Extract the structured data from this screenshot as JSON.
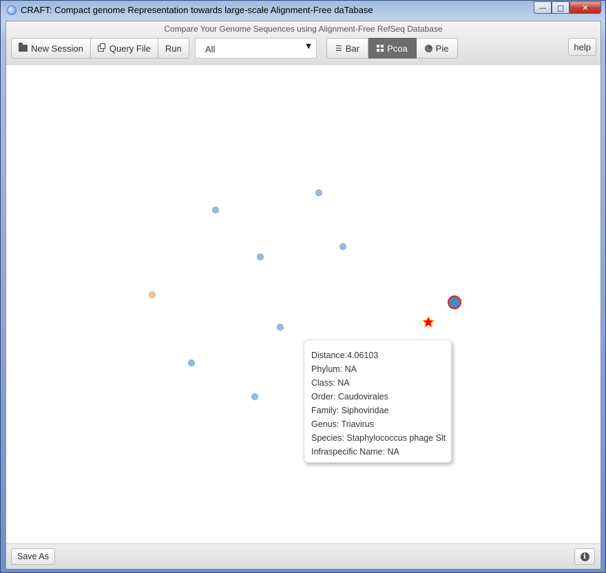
{
  "window": {
    "title": "CRAFT: Compact genome Representation towards large-scale Alignment-Free daTabase",
    "buttons": {
      "minimize": "—",
      "maximize": "□",
      "close": "✕"
    }
  },
  "toolbar": {
    "subtitle": "Compare Your Genome Sequences using Alignment-Free RefSeq Database",
    "new_session": "New Session",
    "query_file": "Query File",
    "run": "Run",
    "filter_value": "All",
    "view_bar": "Bar",
    "view_pcoa": "Pcoa",
    "view_pie": "Pie",
    "active_view": "Pcoa",
    "help": "help"
  },
  "plot": {
    "colors": {
      "point": "#9bbcd9",
      "point_stroke": "#7ea6cb",
      "query": "#f3c29b",
      "selected": "#4a86c0",
      "selected_stroke": "#d62728",
      "star": "#ff0000",
      "star_stroke": "#ffd700"
    }
  },
  "chart_data": {
    "type": "scatter",
    "title": "",
    "xlabel": "",
    "ylabel": "",
    "grid": false,
    "series": [
      {
        "points": [
          [
            312,
            304
          ],
          [
            462,
            279
          ],
          [
            497,
            357
          ],
          [
            377,
            372
          ],
          [
            406,
            474
          ],
          [
            277,
            526
          ],
          [
            369,
            575
          ]
        ]
      },
      {
        "points": [
          [
            220,
            427
          ]
        ]
      },
      {
        "points": [
          [
            659,
            438
          ]
        ]
      },
      {
        "points": [
          [
            621,
            467
          ]
        ]
      }
    ]
  },
  "tooltip": {
    "distance": "Distance:4.06103",
    "phylum": "Phylum: NA",
    "class": "Class: NA",
    "order": "Order: Caudovirales",
    "family": "Family: Siphoviridae",
    "genus": "Genus: Triavirus",
    "species": "Species: Staphylococcus phage Slt",
    "infraspecific": "Infraspecific Name: NA"
  },
  "status": {
    "save_as": "Save As",
    "info_icon": "i"
  }
}
